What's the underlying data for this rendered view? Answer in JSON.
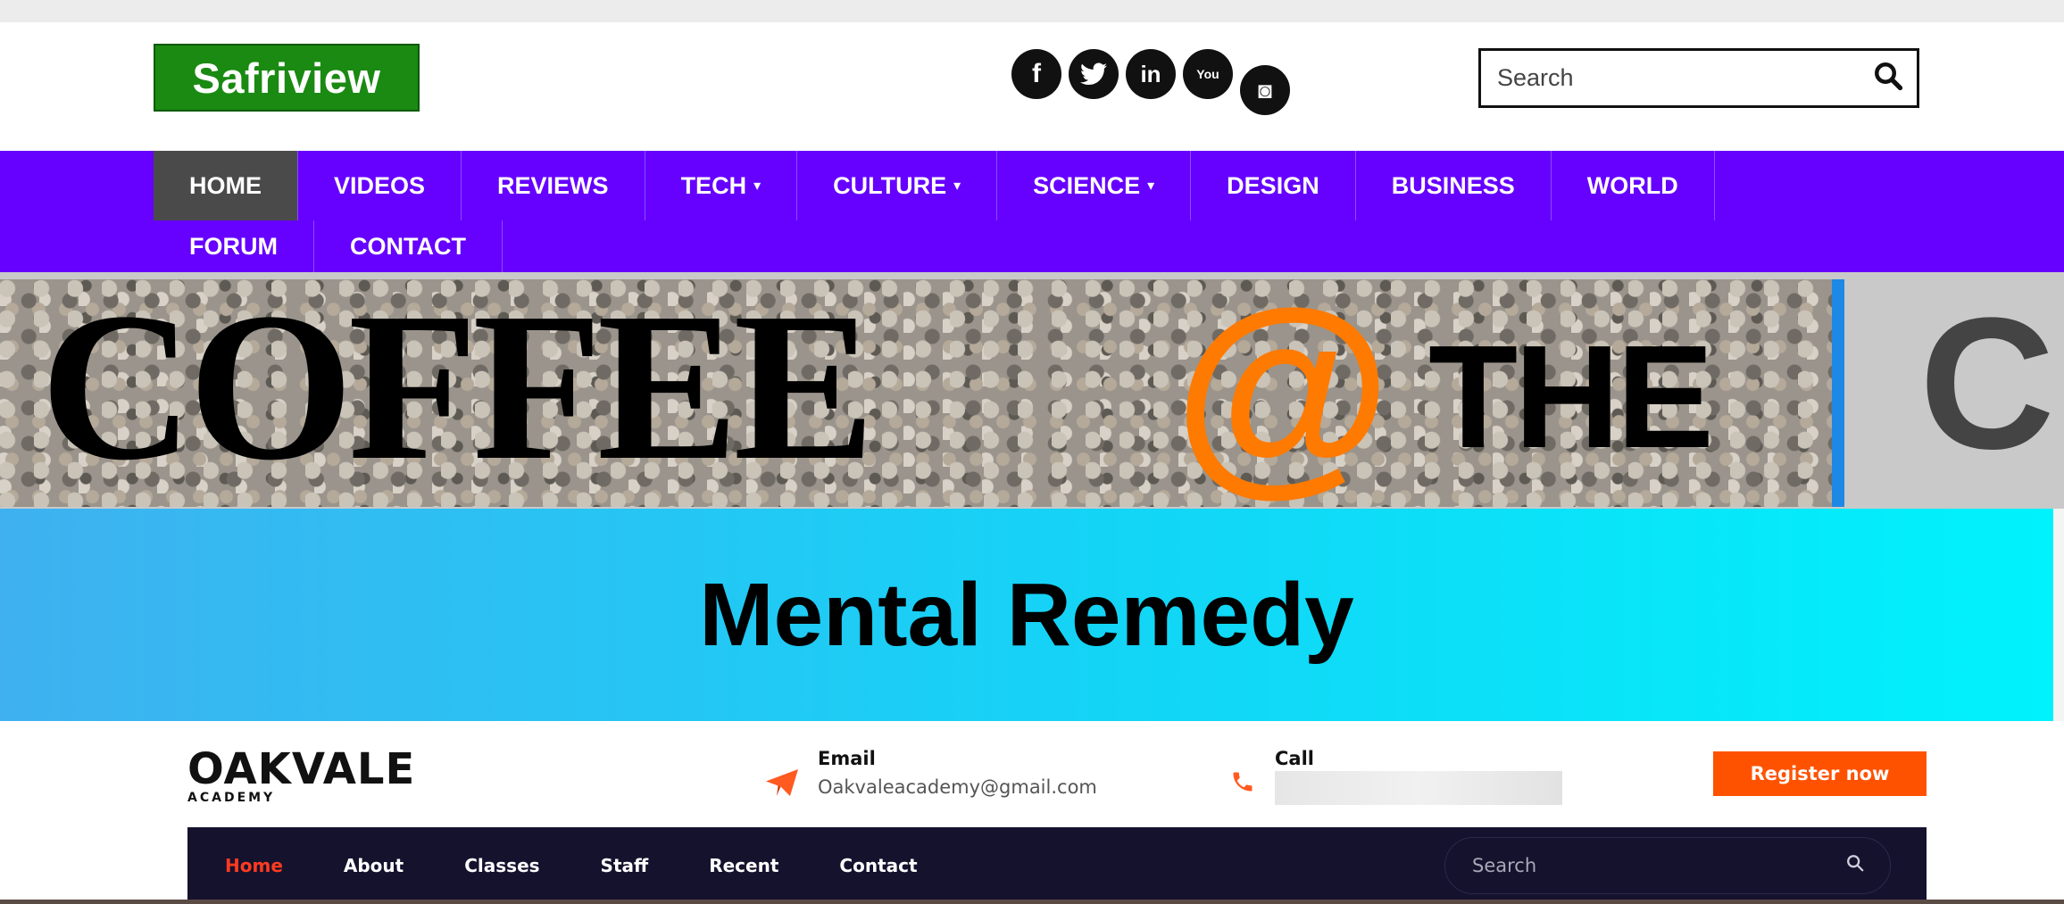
{
  "site": {
    "logo": "Safriview",
    "social_icons": [
      "facebook-icon",
      "twitter-icon",
      "linkedin-icon",
      "youtube-icon",
      "instagram-icon"
    ],
    "social_glyphs": {
      "facebook": "f",
      "twitter": "t",
      "linkedin": "in",
      "youtube": "You",
      "instagram": "◙"
    },
    "search": {
      "placeholder": "Search"
    },
    "nav": {
      "row1": [
        "HOME",
        "VIDEOS",
        "REVIEWS",
        "TECH",
        "CULTURE",
        "SCIENCE",
        "DESIGN",
        "BUSINESS",
        "WORLD"
      ],
      "row2": [
        "FORUM",
        "CONTACT"
      ],
      "dropdown_caret": "▾",
      "active": "HOME",
      "color": "#6600ff"
    }
  },
  "banner": {
    "word1": "COFFEE",
    "at": "@",
    "word2": "THE",
    "tail": "C"
  },
  "mental": {
    "title": "Mental Remedy"
  },
  "oakvale": {
    "logo": "OAKVALE",
    "logo_sub": "ACADEMY",
    "email_label": "Email",
    "email_value": "Oakvaleacademy@gmail.com",
    "call_label": "Call",
    "register": "Register now",
    "nav": [
      "Home",
      "About",
      "Classes",
      "Staff",
      "Recent",
      "Contact"
    ],
    "search_placeholder": "Search",
    "accent": "#ff5200"
  }
}
